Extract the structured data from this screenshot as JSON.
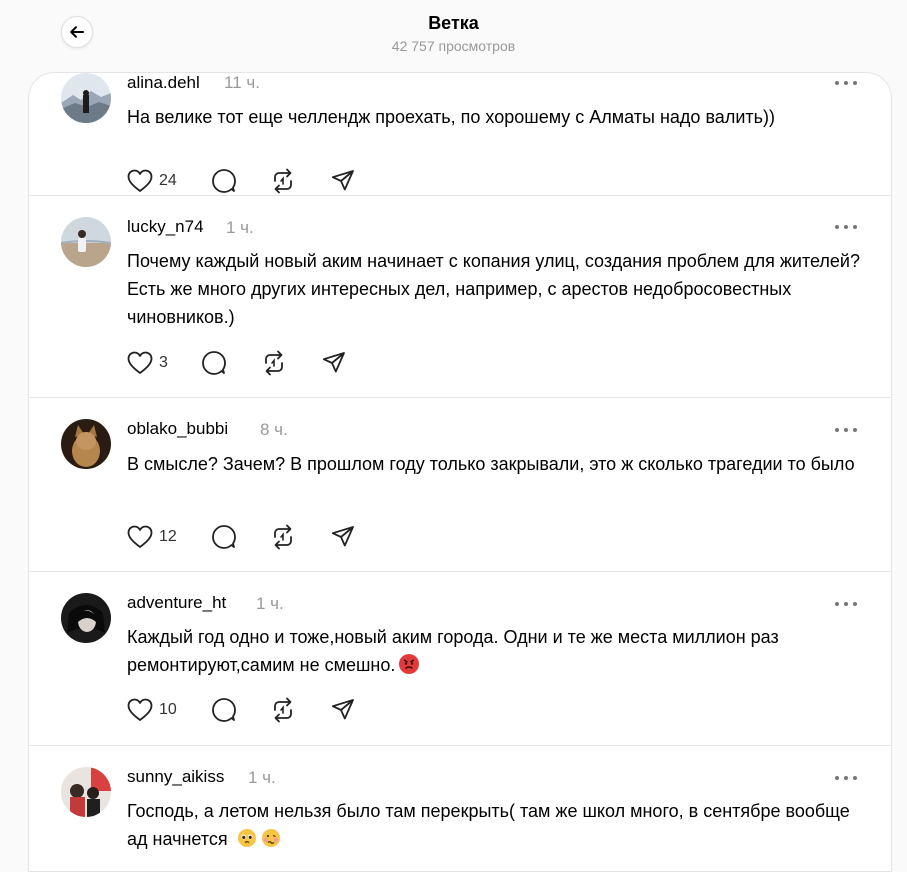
{
  "header": {
    "back_label": "←",
    "title": "Ветка",
    "views": "42 757 просмотров"
  },
  "posts": [
    {
      "username": "alina.dehl",
      "time": "11 ч.",
      "text": "На велике тот еще челлендж проехать, по хорошему с Алматы надо валить))",
      "likes": "24"
    },
    {
      "username": "lucky_n74",
      "time": "1 ч.",
      "text": "Почему каждый новый аким начинает с копания улиц, создания проблем для жителей? Есть же много других интересных дел, например, с арестов недобросовестных чиновников.)",
      "likes": "3"
    },
    {
      "username": "oblako_bubbi",
      "time": "8 ч.",
      "text": "В смысле? Зачем? В прошлом году только закрывали, это ж сколько трагедии то было",
      "likes": "12"
    },
    {
      "username": "adventure_ht",
      "time": "1 ч.",
      "text": "Каждый год одно и тоже,новый аким города. Одни и те же места миллион раз ремонтируют,самим не смешно.",
      "likes": "10",
      "emoji": [
        "angry-face-emoji"
      ]
    },
    {
      "username": "sunny_aikiss",
      "time": "1 ч.",
      "text": "Господь, а летом нельзя было там перекрыть( там же школ много, в сентябре вообще ад начнется",
      "likes": "",
      "emoji": [
        "pleading-face-emoji",
        "woozy-face-emoji"
      ]
    }
  ],
  "colors": {
    "page_bg": "#fafafa",
    "card_bg": "#ffffff",
    "border": "#e5e5e5",
    "muted_text": "#999999"
  },
  "icons": [
    "back-arrow-icon",
    "heart-icon",
    "comment-icon",
    "repost-icon",
    "share-icon",
    "more-icon"
  ]
}
